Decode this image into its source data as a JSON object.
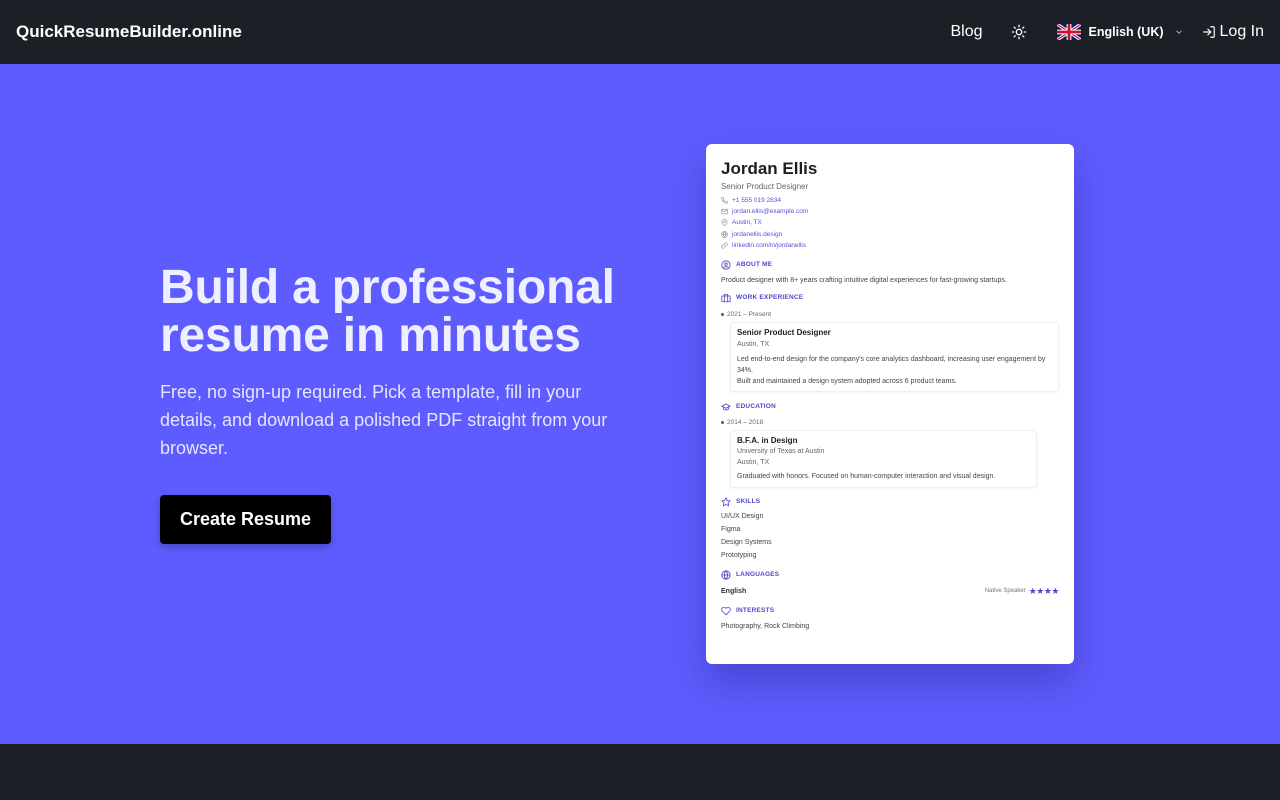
{
  "navbar": {
    "brand": "QuickResumeBuilder.online",
    "blog_label": "Blog",
    "language_label": "English (UK)",
    "login_label": "Log In"
  },
  "hero": {
    "headline_line1": "Build a professional",
    "headline_line2": "resume in minutes",
    "subtext": "Free, no sign-up required. Pick a template, fill in your details, and download a polished PDF straight from your browser.",
    "cta_label": "Create Resume"
  },
  "resume": {
    "name": "Jordan Ellis",
    "title": "Senior Product Designer",
    "contacts": {
      "phone": "+1 555 019 2834",
      "email": "jordan.ellis@example.com",
      "location": "Austin, TX",
      "website": "jordanellis.design",
      "linkedin": "linkedin.com/in/jordanellis"
    },
    "about": {
      "heading": "ABOUT ME",
      "text": "Product designer with 8+ years crafting intuitive digital experiences for fast-growing startups."
    },
    "work": {
      "heading": "WORK EXPERIENCE",
      "date": "2021 – Present",
      "role": "Senior Product Designer",
      "location": "Austin, TX",
      "bullet1": "Led end-to-end design for the company's core analytics dashboard, increasing user engagement by 34%.",
      "bullet2": "Built and maintained a design system adopted across 6 product teams."
    },
    "education": {
      "heading": "EDUCATION",
      "date": "2014 – 2018",
      "degree": "B.F.A. in Design",
      "school": "University of Texas at Austin",
      "location": "Austin, TX",
      "note": "Graduated with honors. Focused on human-computer interaction and visual design."
    },
    "skills": {
      "heading": "SKILLS",
      "items": [
        "UI/UX Design",
        "Figma",
        "Design Systems",
        "Prototyping"
      ]
    },
    "languages": {
      "heading": "LANGUAGES",
      "name": "English",
      "level": "Native Speaker",
      "stars": "★★★★"
    },
    "interests": {
      "heading": "INTERESTS",
      "text": "Photography, Rock Climbing"
    }
  },
  "colors": {
    "hero_background": "#5f5cff",
    "navbar_background": "#1c2026",
    "accent": "#4d49c8",
    "cta_background": "#000000"
  },
  "icons": [
    "sun-icon",
    "uk-flag-icon",
    "chevron-down-icon",
    "login-icon",
    "phone-icon",
    "mail-icon",
    "map-pin-icon",
    "globe-icon",
    "link-icon",
    "user-circle-icon",
    "briefcase-icon",
    "graduation-cap-icon",
    "star-icon",
    "heart-icon"
  ]
}
